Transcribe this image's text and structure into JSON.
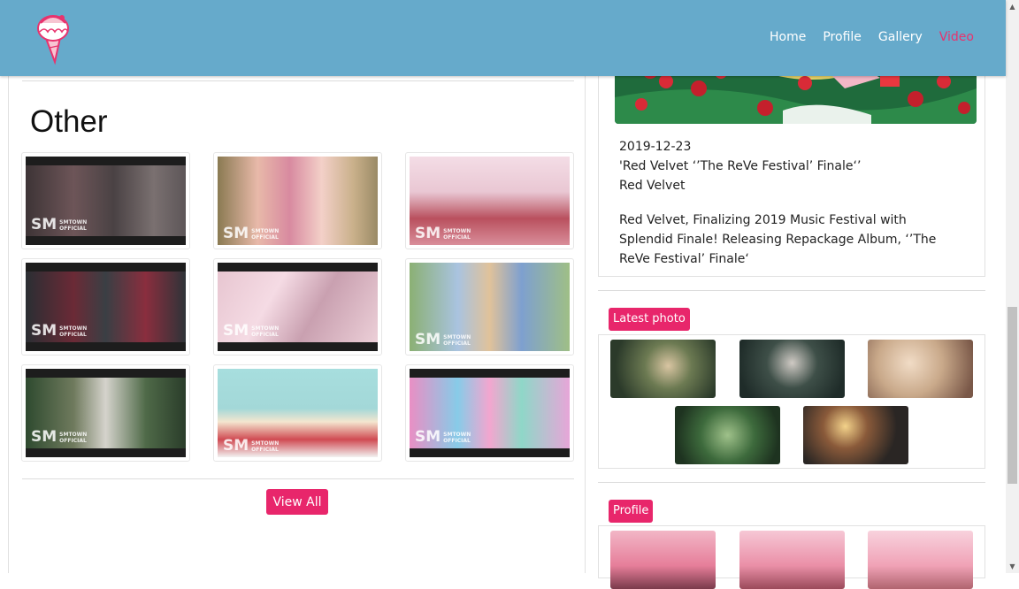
{
  "nav": {
    "links": [
      {
        "label": "Home",
        "active": false
      },
      {
        "label": "Profile",
        "active": false
      },
      {
        "label": "Gallery",
        "active": false
      },
      {
        "label": "Video",
        "active": true
      }
    ],
    "active_color": "#e8336e",
    "bar_color": "#66aacb"
  },
  "other": {
    "title": "Other",
    "watermark_line1": "SMTOWN",
    "watermark_line2": "OFFICIAL",
    "view_all": "View All"
  },
  "news": {
    "date": "2019-12-23",
    "title": "'Red Velvet ‘’The ReVe Festival’ Finale‘’",
    "artist": "Red Velvet",
    "description": "Red Velvet, Finalizing 2019 Music Festival with Splendid Finale! Releasing Repackage Album, ‘’The ReVe Festival’ Finale‘"
  },
  "latest_photo": {
    "label": "Latest photo"
  },
  "profile": {
    "label": "Profile"
  },
  "accent_color": "#e8266b"
}
